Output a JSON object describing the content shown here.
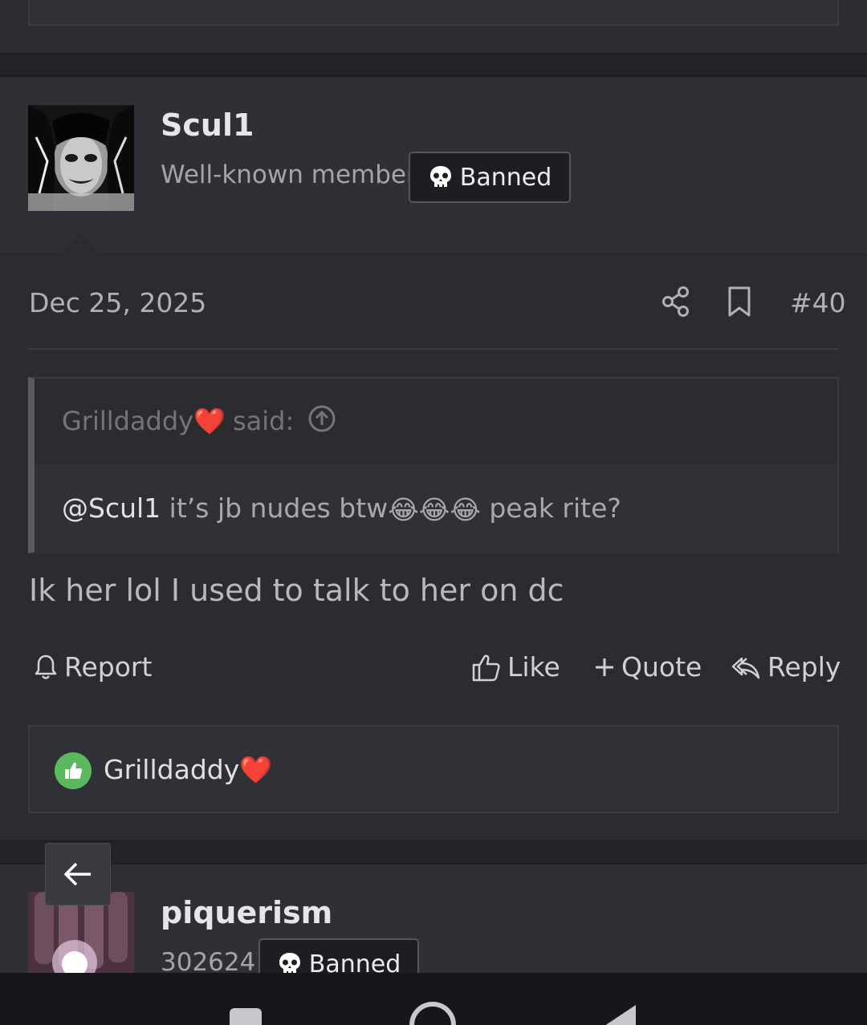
{
  "post": {
    "author": {
      "name": "Scul1",
      "title": "Well-known member",
      "badge": "Banned",
      "avatar_icon": "avatar-dark-portrait"
    },
    "date": "Dec 25, 2025",
    "number": "#40",
    "quote": {
      "author": "Grilldaddy❤️",
      "said": "said:",
      "mention": "@Scul1",
      "text_before": " it’s jb nudes btw",
      "emojis": [
        "😂",
        "😂",
        "😂"
      ],
      "text_after": " peak rite?"
    },
    "message": "Ik her lol I used to talk to her on dc",
    "actions": {
      "report": "Report",
      "like": "Like",
      "quote": "Quote",
      "reply": "Reply"
    },
    "reactions": {
      "icon": "thumbs-up-icon",
      "users": "Grilldaddy❤️"
    }
  },
  "next_post": {
    "author": {
      "name": "piquerism",
      "title": "302624",
      "badge": "Banned"
    }
  },
  "colors": {
    "background": "#2b2c30",
    "like_green": "#5cb85c",
    "badge_bg": "#1d1e21"
  }
}
